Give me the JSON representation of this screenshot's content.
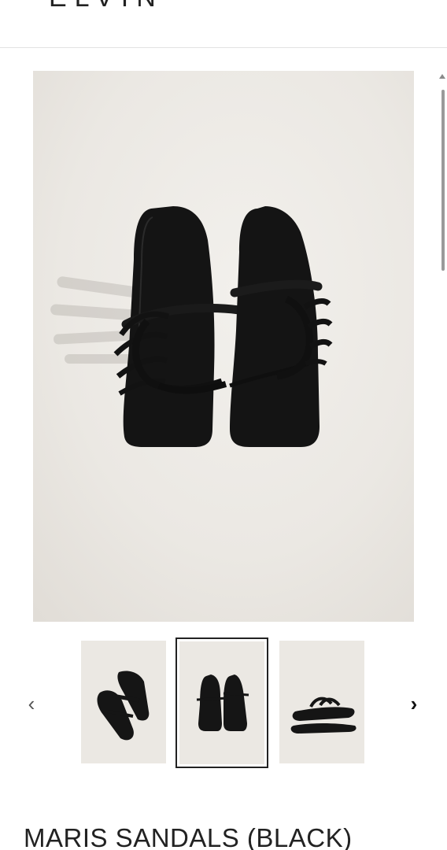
{
  "header": {
    "logo_text": "ELVIN"
  },
  "gallery": {
    "main_image_alt": "Black strappy square-toe slide sandals",
    "prev_icon": "chevron-left-icon",
    "next_icon": "chevron-right-icon",
    "prev_glyph": "‹",
    "next_glyph": "›",
    "thumbnails": [
      {
        "label": "angled view",
        "selected": false
      },
      {
        "label": "top view",
        "selected": true
      },
      {
        "label": "side view",
        "selected": false
      }
    ]
  },
  "product": {
    "title": "MARIS SANDALS (BLACK)"
  },
  "colors": {
    "accent": "#222222",
    "background": "#ebe8e3",
    "sandal": "#151515"
  }
}
